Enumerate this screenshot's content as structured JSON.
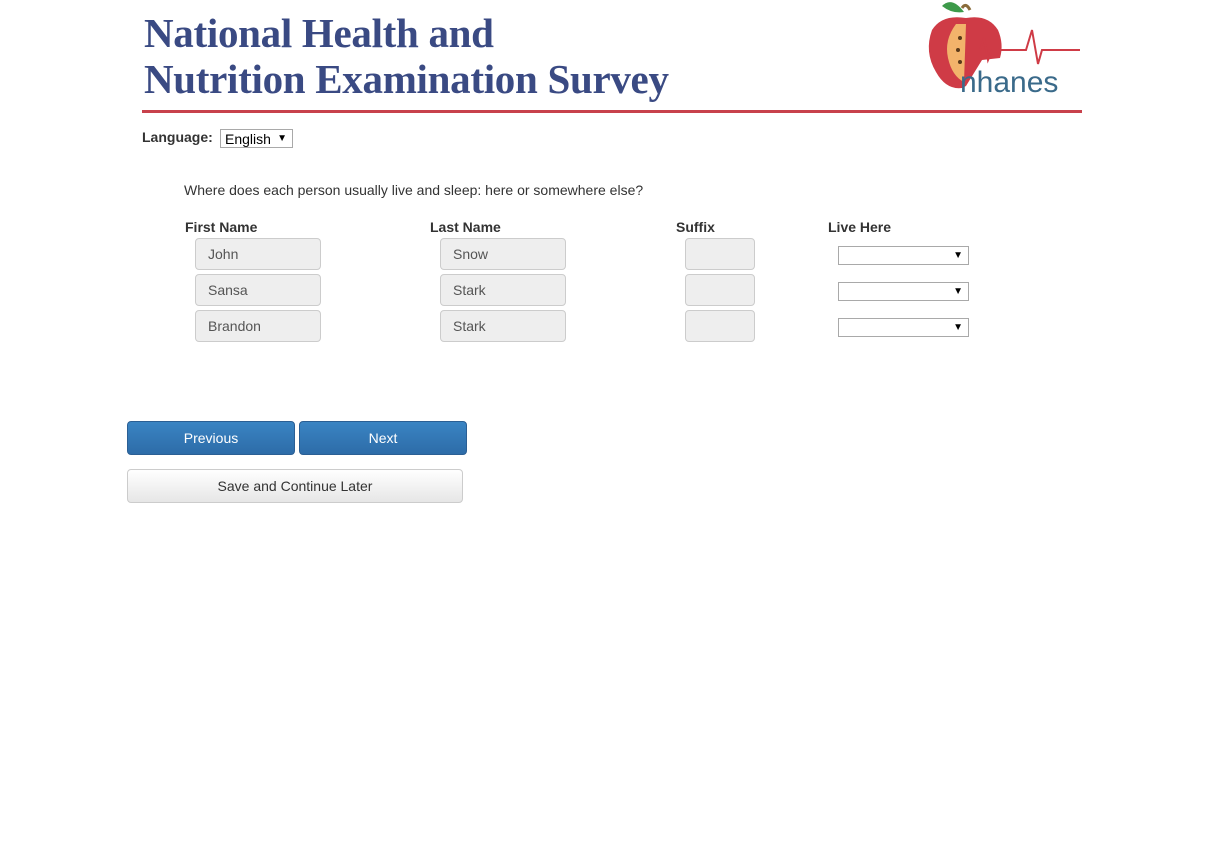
{
  "header": {
    "title_line1": "National Health and",
    "title_line2": "Nutrition Examination Survey",
    "logo_text": "nhanes"
  },
  "language": {
    "label": "Language:",
    "selected": "English"
  },
  "question": "Where does each person usually live and sleep: here or somewhere else?",
  "columns": {
    "first_name": "First Name",
    "last_name": "Last Name",
    "suffix": "Suffix",
    "live_here": "Live Here"
  },
  "people": [
    {
      "first": "John",
      "last": "Snow",
      "suffix": "",
      "live_here": ""
    },
    {
      "first": "Sansa",
      "last": "Stark",
      "suffix": "",
      "live_here": ""
    },
    {
      "first": "Brandon",
      "last": "Stark",
      "suffix": "",
      "live_here": ""
    }
  ],
  "buttons": {
    "previous": "Previous",
    "next": "Next",
    "save_later": "Save and Continue Later"
  },
  "colors": {
    "title": "#3a4a83",
    "accent_red": "#c8414c",
    "primary": "#2d6ca8"
  }
}
